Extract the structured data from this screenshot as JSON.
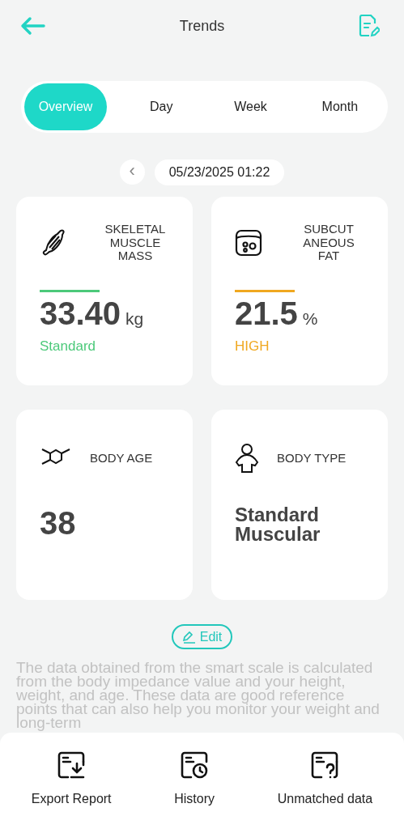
{
  "header": {
    "title": "Trends"
  },
  "tabs": [
    {
      "label": "Overview",
      "selected": true
    },
    {
      "label": "Day",
      "selected": false
    },
    {
      "label": "Week",
      "selected": false
    },
    {
      "label": "Month",
      "selected": false
    }
  ],
  "date": {
    "prev": "‹",
    "value": "05/23/2025 01:22"
  },
  "cards": [
    {
      "kind": "metric",
      "title": "SKELETAL MUSCLE MASS",
      "value": "33.40",
      "unit": "kg",
      "status": "Standard",
      "color": "#4cc97a"
    },
    {
      "kind": "metric",
      "title": "SUBCUT ANEOUS FAT",
      "value": "21.5",
      "unit": "%",
      "status": "HIGH",
      "color": "#f0a820"
    },
    {
      "kind": "plain",
      "title": "BODY AGE",
      "value": "38"
    },
    {
      "kind": "plain",
      "title": "BODY TYPE",
      "value": "Standard Muscular"
    }
  ],
  "edit_button": "Edit",
  "note": "The data obtained from the smart scale is calculated from the body impedance value and your height, weight, and age. These data are good reference points that can also help you monitor your weight and long-term",
  "actions": [
    {
      "label": "Export Report"
    },
    {
      "label": "History"
    },
    {
      "label": "Unmatched data"
    }
  ]
}
